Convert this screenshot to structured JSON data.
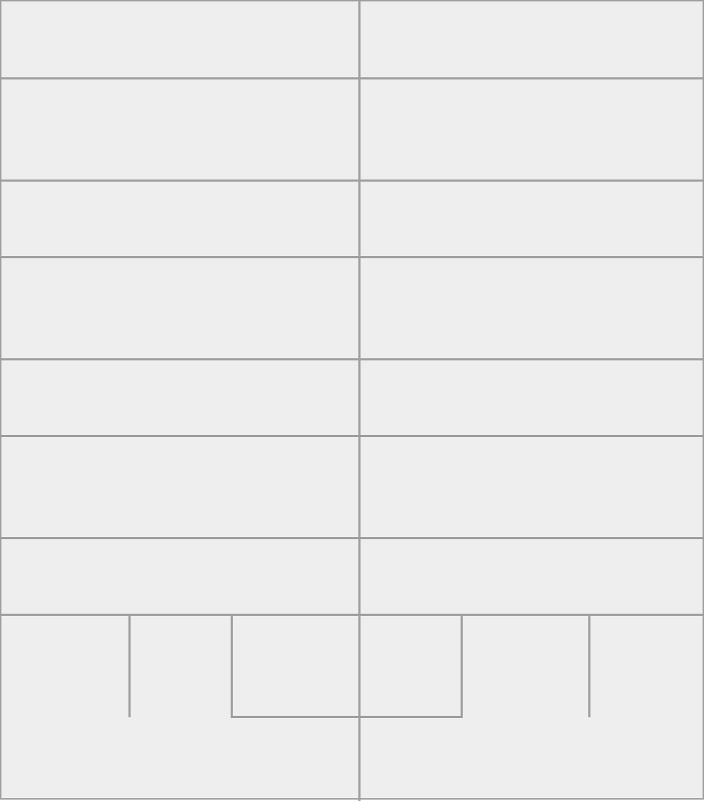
{
  "canvas": {
    "background": "#eeeeee",
    "line_color": "#9e9e9e"
  },
  "layout": {
    "columns": 2,
    "row_bands": 8,
    "bottom_band_dividers": 4
  }
}
